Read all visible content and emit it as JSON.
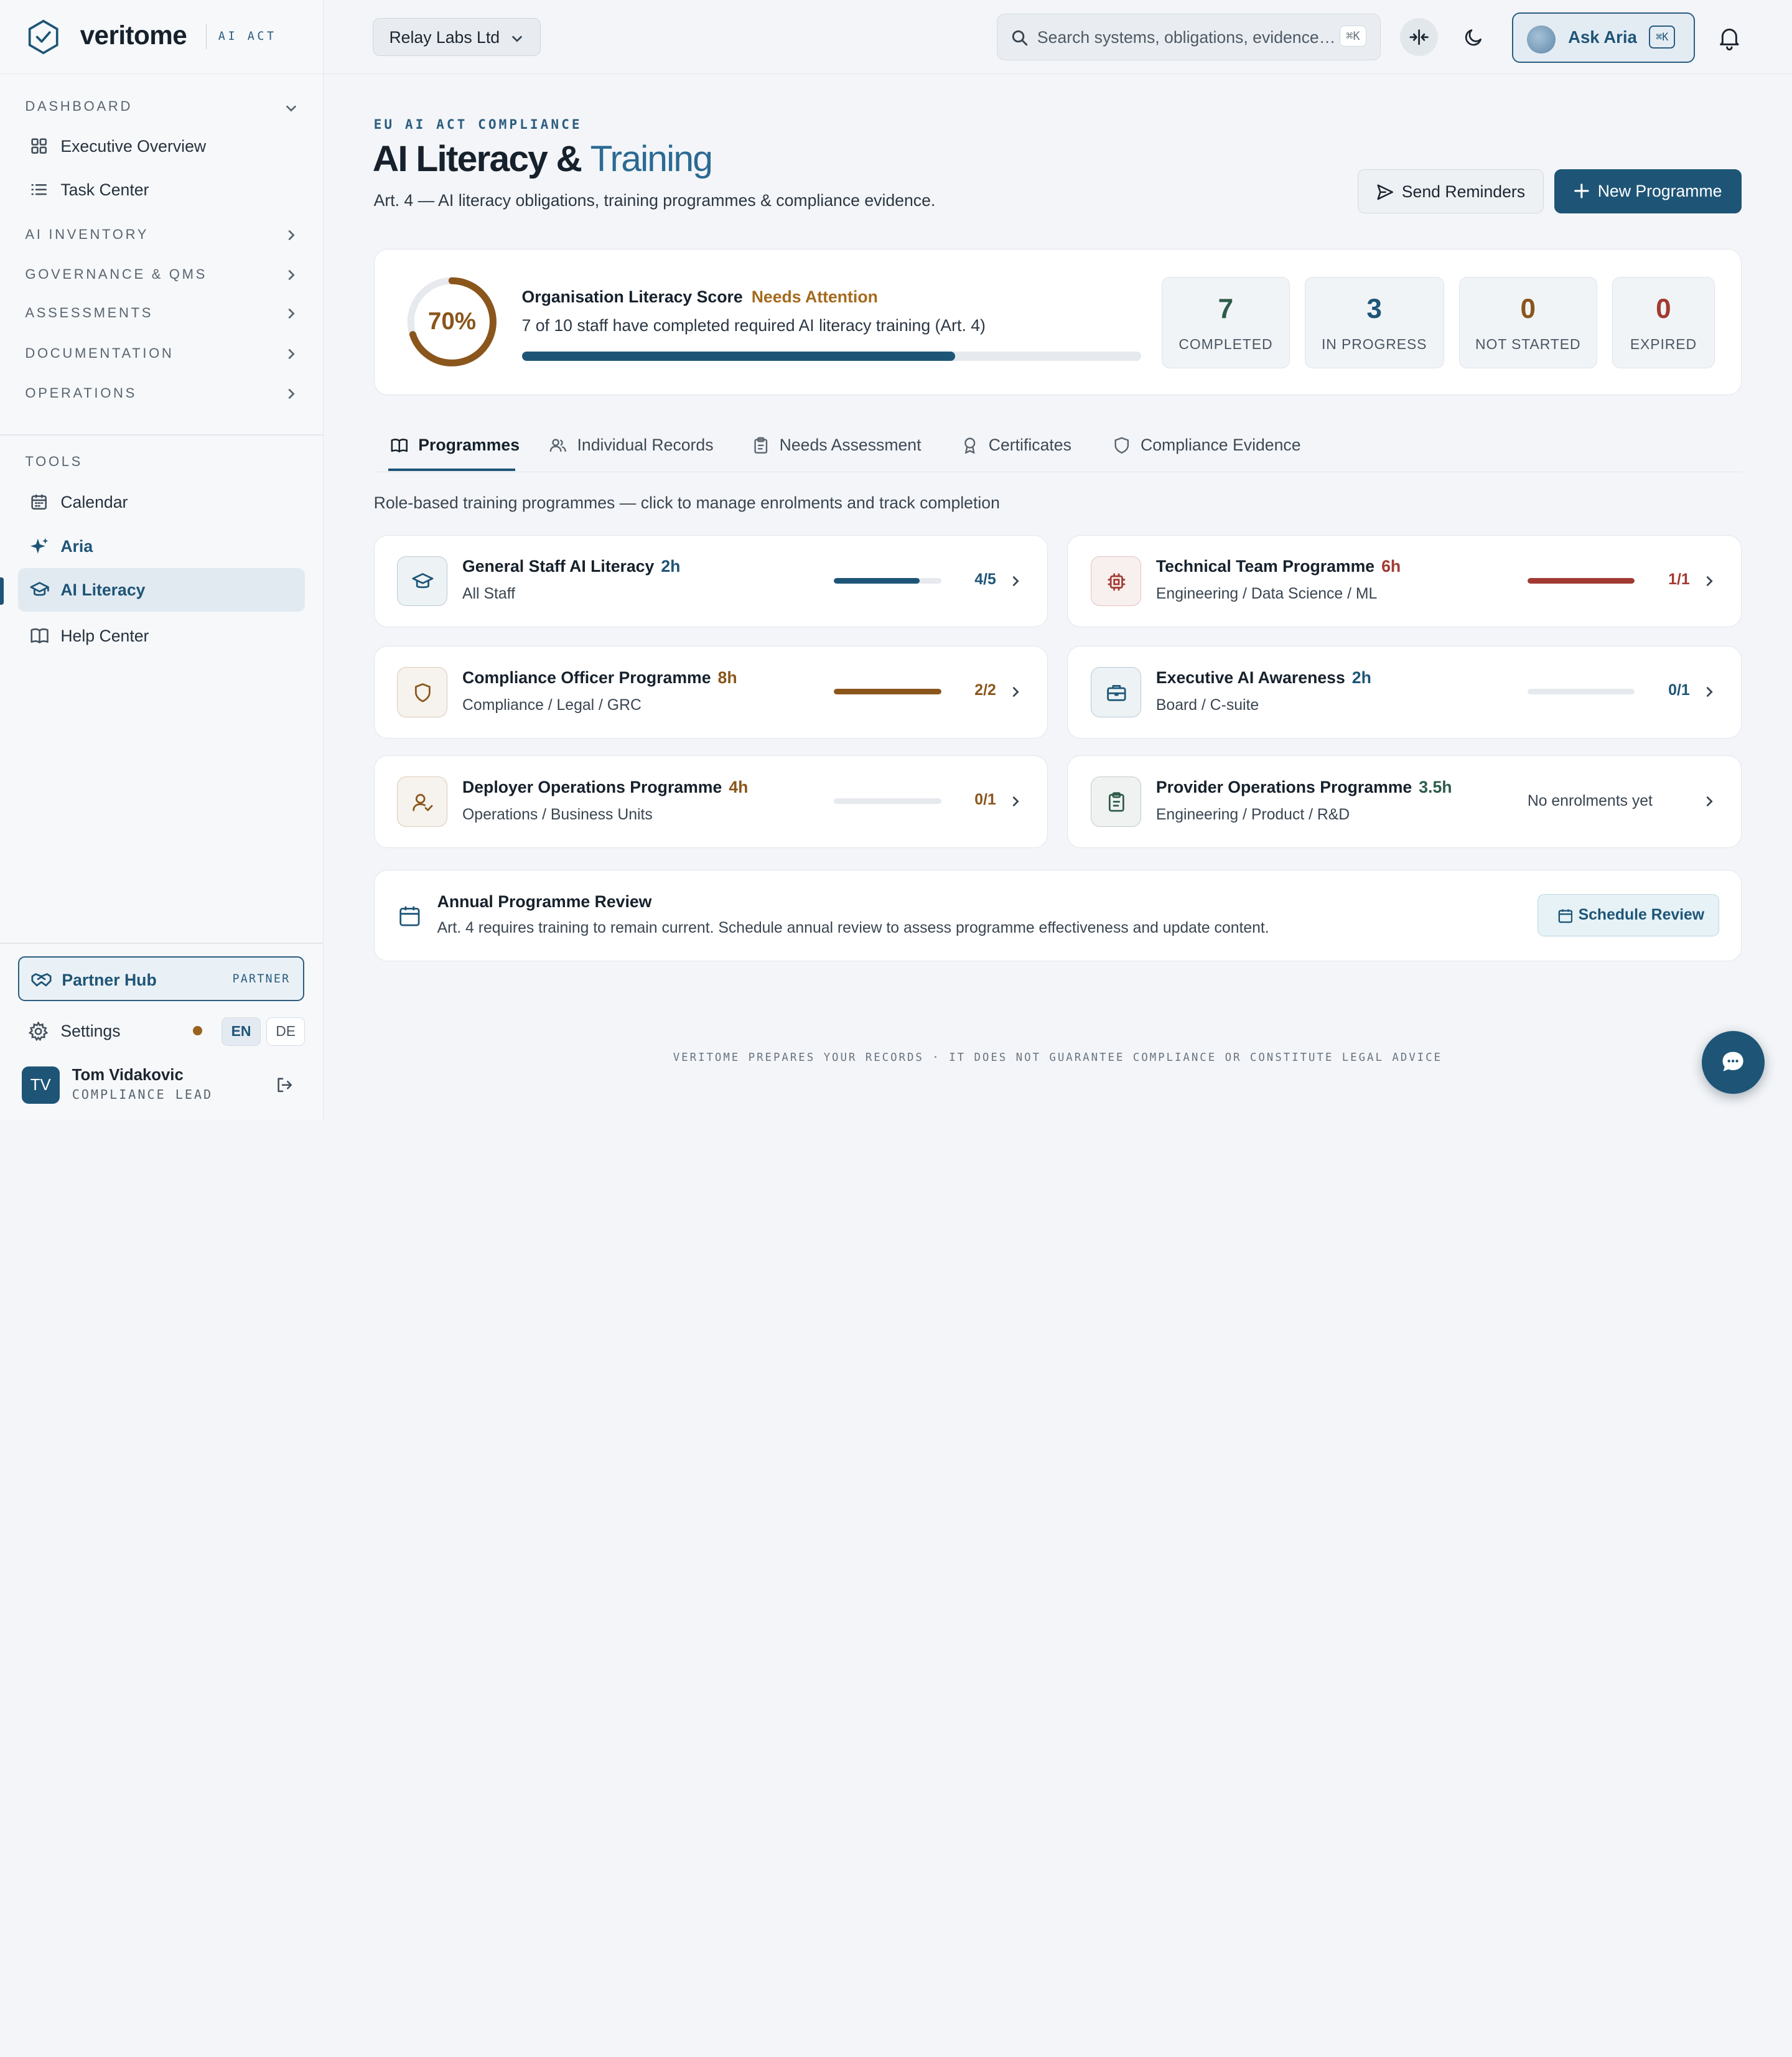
{
  "brand": {
    "name": "veritome",
    "tag": "AI ACT",
    "accent": "#1e5577"
  },
  "sidebar": {
    "sections": [
      {
        "label": "DASHBOARD",
        "expanded": true
      },
      {
        "label": "AI INVENTORY"
      },
      {
        "label": "GOVERNANCE & QMS"
      },
      {
        "label": "ASSESSMENTS"
      },
      {
        "label": "DOCUMENTATION"
      },
      {
        "label": "OPERATIONS"
      }
    ],
    "dashboard_items": [
      {
        "label": "Executive Overview",
        "icon": "grid-icon"
      },
      {
        "label": "Task Center",
        "icon": "list-icon"
      }
    ],
    "tools_label": "TOOLS",
    "tools_items": [
      {
        "label": "Calendar",
        "icon": "calendar-icon"
      },
      {
        "label": "Aria",
        "icon": "sparkle-icon"
      },
      {
        "label": "AI Literacy",
        "icon": "graduation-cap-icon",
        "active": true
      },
      {
        "label": "Help Center",
        "icon": "book-icon"
      }
    ],
    "partner": {
      "label": "Partner Hub",
      "badge": "PARTNER"
    },
    "settings": {
      "label": "Settings",
      "lang": [
        "EN",
        "DE"
      ],
      "lang_selected": "EN"
    },
    "user": {
      "initials": "TV",
      "name": "Tom Vidakovic",
      "role": "COMPLIANCE LEAD"
    }
  },
  "topbar": {
    "org": "Relay Labs Ltd",
    "search": {
      "placeholder": "Search systems, obligations, evidence…",
      "shortcut": "⌘K"
    },
    "ask": {
      "label": "Ask Aria",
      "shortcut": "⌘K"
    }
  },
  "page": {
    "eyebrow": "EU AI ACT COMPLIANCE",
    "title_main": "AI Literacy &",
    "title_accent": "Training",
    "subtitle": "Art. 4 — AI literacy obligations, training programmes & compliance evidence.",
    "actions": {
      "reminders": "Send Reminders",
      "new": "New Programme"
    }
  },
  "score": {
    "percent": 70,
    "percent_label": "70%",
    "title": "Organisation Literacy Score",
    "status": "Needs Attention",
    "desc": "7 of 10 staff have completed required AI literacy training (Art. 4)",
    "stats": [
      {
        "value": "7",
        "label": "COMPLETED",
        "color": "#2e5c4a"
      },
      {
        "value": "3",
        "label": "IN PROGRESS",
        "color": "#1e5577"
      },
      {
        "value": "0",
        "label": "NOT STARTED",
        "color": "#8a561c"
      },
      {
        "value": "0",
        "label": "EXPIRED",
        "color": "#a23a32"
      }
    ]
  },
  "tabs": [
    {
      "label": "Programmes",
      "icon": "book-open-icon",
      "active": true
    },
    {
      "label": "Individual Records",
      "icon": "users-icon"
    },
    {
      "label": "Needs Assessment",
      "icon": "clipboard-icon"
    },
    {
      "label": "Certificates",
      "icon": "award-icon"
    },
    {
      "label": "Compliance Evidence",
      "icon": "shield-icon"
    }
  ],
  "tabs_desc": "Role-based training programmes — click to manage enrolments and track completion",
  "programmes": [
    {
      "name": "General Staff AI Literacy",
      "hours": "2h",
      "audience": "All Staff",
      "count": "4/5",
      "progress": 0.8,
      "color": "#1e5577",
      "icon": "graduation-cap-icon"
    },
    {
      "name": "Technical Team Programme",
      "hours": "6h",
      "audience": "Engineering / Data Science / ML",
      "count": "1/1",
      "progress": 1.0,
      "color": "#a23a32",
      "icon": "chip-icon"
    },
    {
      "name": "Compliance Officer Programme",
      "hours": "8h",
      "audience": "Compliance / Legal / GRC",
      "count": "2/2",
      "progress": 1.0,
      "color": "#8a561c",
      "icon": "shield-icon"
    },
    {
      "name": "Executive AI Awareness",
      "hours": "2h",
      "audience": "Board / C-suite",
      "count": "0/1",
      "progress": 0,
      "color": "#1e5577",
      "icon": "briefcase-icon"
    },
    {
      "name": "Deployer Operations Programme",
      "hours": "4h",
      "audience": "Operations / Business Units",
      "count": "0/1",
      "progress": 0,
      "color": "#8a561c",
      "icon": "user-check-icon"
    },
    {
      "name": "Provider Operations Programme",
      "hours": "3.5h",
      "audience": "Engineering / Product / R&D",
      "empty": "No enrolments yet",
      "color": "#2e5c4a",
      "icon": "clipboard-icon"
    }
  ],
  "review": {
    "title": "Annual Programme Review",
    "desc": "Art. 4 requires training to remain current. Schedule annual review to assess programme effectiveness and update content.",
    "button": "Schedule Review"
  },
  "footer": "VERITOME PREPARES YOUR RECORDS · IT DOES NOT GUARANTEE COMPLIANCE OR CONSTITUTE LEGAL ADVICE"
}
